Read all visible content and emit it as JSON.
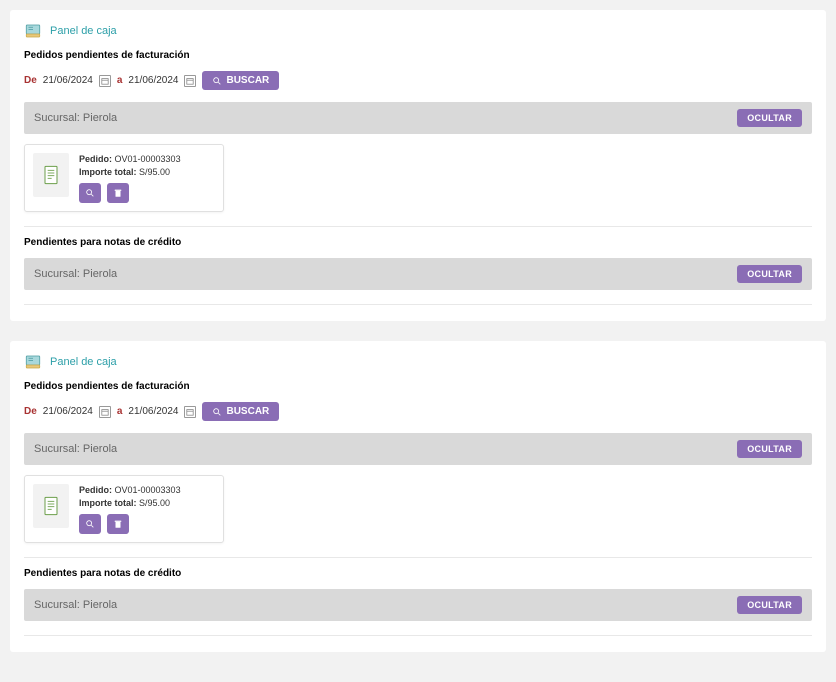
{
  "panels": [
    {
      "title": "Panel de caja",
      "sectionLabel": "Pedidos pendientes de facturación",
      "filter": {
        "de": "De",
        "dateFrom": "21/06/2024",
        "a": "a",
        "dateTo": "21/06/2024",
        "searchLabel": "BUSCAR"
      },
      "branch": {
        "label": "Sucursal: Pierola",
        "hideLabel": "OCULTAR"
      },
      "order": {
        "pedidoLabel": "Pedido:",
        "pedidoCode": "OV01-00003303",
        "importeLabel": "Importe total:",
        "importeVal": "S/95.00"
      },
      "creditSection": {
        "label": "Pendientes para notas de crédito",
        "branchLabel": "Sucursal: Pierola",
        "hideLabel": "OCULTAR"
      }
    },
    {
      "title": "Panel de caja",
      "sectionLabel": "Pedidos pendientes de facturación",
      "filter": {
        "de": "De",
        "dateFrom": "21/06/2024",
        "a": "a",
        "dateTo": "21/06/2024",
        "searchLabel": "BUSCAR"
      },
      "branch": {
        "label": "Sucursal: Pierola",
        "hideLabel": "OCULTAR"
      },
      "order": {
        "pedidoLabel": "Pedido:",
        "pedidoCode": "OV01-00003303",
        "importeLabel": "Importe total:",
        "importeVal": "S/95.00"
      },
      "creditSection": {
        "label": "Pendientes para notas de crédito",
        "branchLabel": "Sucursal: Pierola",
        "hideLabel": "OCULTAR"
      }
    }
  ]
}
